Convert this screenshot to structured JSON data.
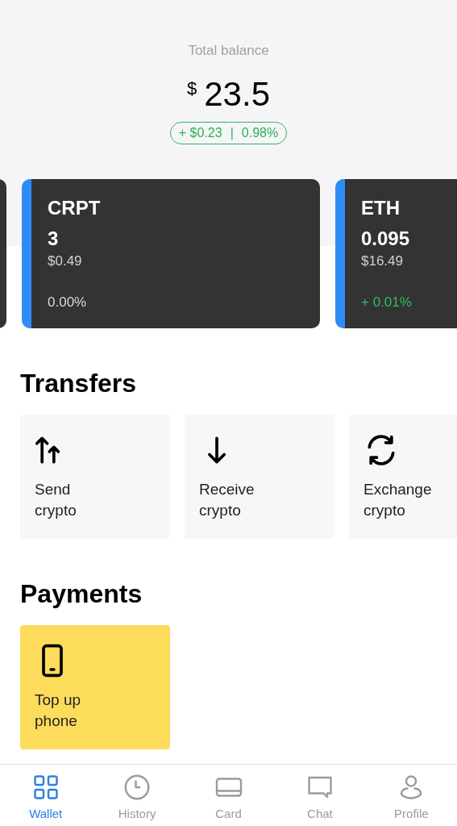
{
  "balance": {
    "label": "Total balance",
    "currency": "$",
    "amount": "23.5",
    "change": "+ $0.23",
    "separator": "|",
    "percent": "0.98%"
  },
  "assets": [
    {
      "kind": "partial"
    },
    {
      "kind": "full",
      "symbol": "CRPT",
      "amount": "3",
      "value": "$0.49",
      "change": "0.00%",
      "color": "#d8d8d8"
    },
    {
      "kind": "full",
      "symbol": "ETH",
      "amount": "0.095",
      "value": "$16.49",
      "change": "+ 0.01%",
      "color": "#2fbf5e"
    }
  ],
  "transfers": {
    "title": "Transfers",
    "actions": [
      {
        "kind": "send",
        "label": "Send\ncrypto"
      },
      {
        "kind": "receive",
        "label": "Receive\ncrypto"
      },
      {
        "kind": "exchange",
        "label": "Exchange\ncrypto"
      }
    ]
  },
  "payments": {
    "title": "Payments",
    "actions": [
      {
        "kind": "phone",
        "label": "Top up\nphone"
      }
    ]
  },
  "tab_bar": [
    {
      "kind": "wallet",
      "label": "Wallet",
      "selected": true
    },
    {
      "kind": "history",
      "label": "History",
      "selected": false
    },
    {
      "kind": "card",
      "label": "Card",
      "selected": false
    },
    {
      "kind": "chat",
      "label": "Chat",
      "selected": false
    },
    {
      "kind": "profile",
      "label": "Profile",
      "selected": false
    }
  ]
}
